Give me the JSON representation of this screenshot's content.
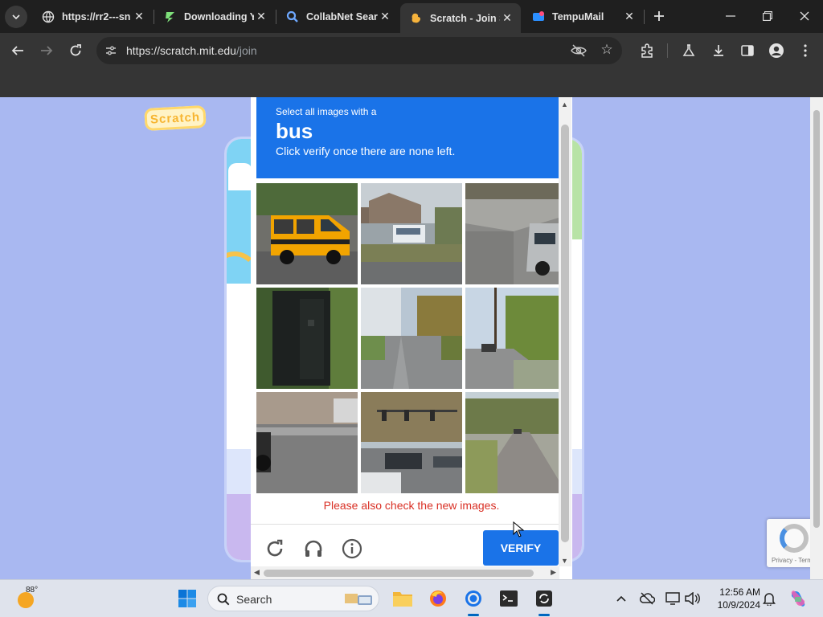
{
  "browser": {
    "tabs": [
      {
        "title": "https://rr2---sn",
        "favicon": "globe-icon"
      },
      {
        "title": "Downloading Yo",
        "favicon": "bolt-icon"
      },
      {
        "title": "CollabNet Sear",
        "favicon": "search-icon"
      },
      {
        "title": "Scratch - Join S",
        "favicon": "scratch-icon",
        "active": true
      },
      {
        "title": "TempuMail",
        "favicon": "tempumail-icon"
      }
    ],
    "url_domain": "https://scratch.mit.edu",
    "url_path": "/join"
  },
  "page": {
    "logo_text": "Scratch",
    "recaptcha_terms": "Privacy - Terms"
  },
  "captcha": {
    "instruction_line1": "Select all images with a",
    "target_word": "bus",
    "instruction_line3": "Click verify once there are none left.",
    "tiles": [
      {
        "label": "school-van"
      },
      {
        "label": "house-with-bus"
      },
      {
        "label": "suv-intersection"
      },
      {
        "label": "dark-box"
      },
      {
        "label": "tree-lined-street"
      },
      {
        "label": "street-with-pole"
      },
      {
        "label": "street-with-motorcycle"
      },
      {
        "label": "traffic-light-intersection"
      },
      {
        "label": "empty-road"
      }
    ],
    "message": "Please also check the new images.",
    "verify_label": "VERIFY",
    "colors": {
      "accent": "#1a73e8",
      "error": "#d93025"
    }
  },
  "taskbar": {
    "weather_temp": "88°",
    "search_placeholder": "Search",
    "time": "12:56 AM",
    "date": "10/9/2024"
  }
}
